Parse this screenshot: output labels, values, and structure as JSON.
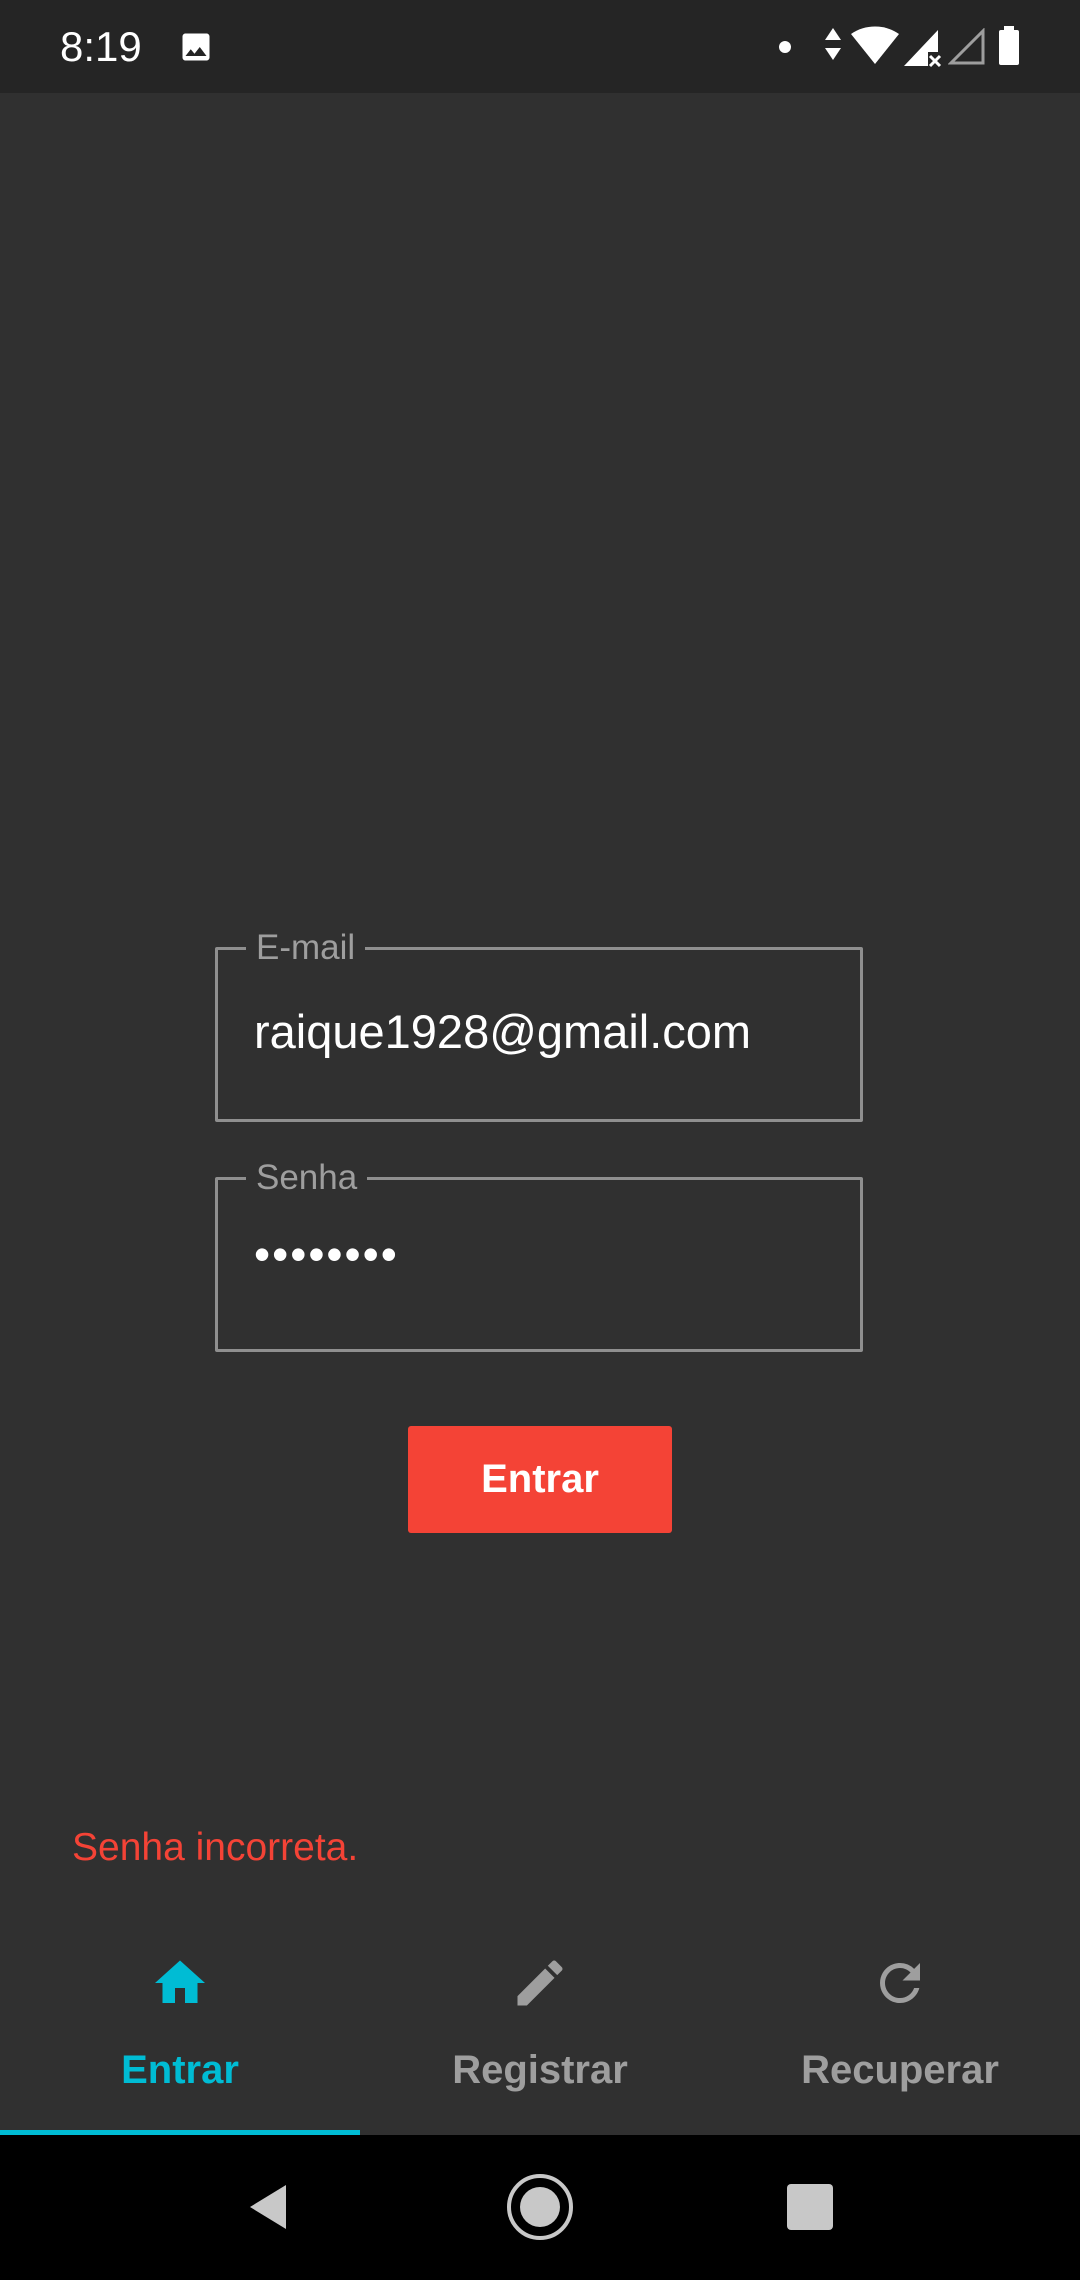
{
  "status_bar": {
    "time": "8:19",
    "icons": [
      "gallery-icon",
      "dot-icon",
      "data-arrows-icon",
      "wifi-icon",
      "signal-x-icon",
      "signal-empty-icon",
      "battery-icon"
    ]
  },
  "login_form": {
    "email": {
      "label": "E-mail",
      "value": "raique1928@gmail.com"
    },
    "password": {
      "label": "Senha",
      "value": "••••••••"
    },
    "submit_label": "Entrar"
  },
  "error_message": "Senha incorreta.",
  "bottom_nav": {
    "active_tab": "Entrar",
    "tabs": [
      {
        "label": "Entrar",
        "icon": "home-icon"
      },
      {
        "label": "Registrar",
        "icon": "pencil-icon"
      },
      {
        "label": "Recuperar",
        "icon": "refresh-icon"
      }
    ]
  },
  "system_nav": [
    "back-icon",
    "home-circle-icon",
    "recents-icon"
  ],
  "colors": {
    "background": "#303030",
    "status_bar": "#252525",
    "accent": "#00bcd4",
    "button": "#f44336",
    "error": "#f44336",
    "inactive": "#9e9e9e"
  }
}
